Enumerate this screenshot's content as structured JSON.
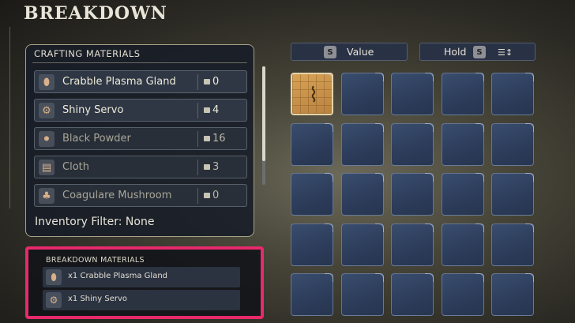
{
  "page_title": "BREAKDOWN",
  "crafting": {
    "header": "CRAFTING MATERIALS",
    "items": [
      {
        "name": "Crabble Plasma Gland",
        "count": "0",
        "icon": "gland-icon",
        "glyph": "⬮",
        "dim": false
      },
      {
        "name": "Shiny Servo",
        "count": "4",
        "icon": "servo-icon",
        "glyph": "⚙",
        "dim": false
      },
      {
        "name": "Black Powder",
        "count": "16",
        "icon": "powder-icon",
        "glyph": "⚫",
        "dim": true
      },
      {
        "name": "Cloth",
        "count": "3",
        "icon": "cloth-icon",
        "glyph": "▤",
        "dim": true
      },
      {
        "name": "Coagulare Mushroom",
        "count": "0",
        "icon": "mushroom-icon",
        "glyph": "♣",
        "dim": true
      }
    ],
    "filter_label": "Inventory Filter: None"
  },
  "breakdown": {
    "header": "BREAKDOWN MATERIALS",
    "items": [
      {
        "label": "x1 Crabble Plasma Gland",
        "icon": "gland-icon",
        "glyph": "⬮"
      },
      {
        "label": "x1 Shiny Servo",
        "icon": "servo-icon",
        "glyph": "⚙"
      }
    ],
    "highlight_color": "#e8296b"
  },
  "sort_value_button": {
    "key": "S",
    "label": "Value"
  },
  "hold_button": {
    "label": "Hold",
    "key": "S",
    "icon": "sort-icon",
    "glyph": "☰↕"
  },
  "grid": {
    "rows": 5,
    "cols": 5,
    "selected_slot_icon": "blaster-icon",
    "selected_slot_glyph": "⌇"
  }
}
